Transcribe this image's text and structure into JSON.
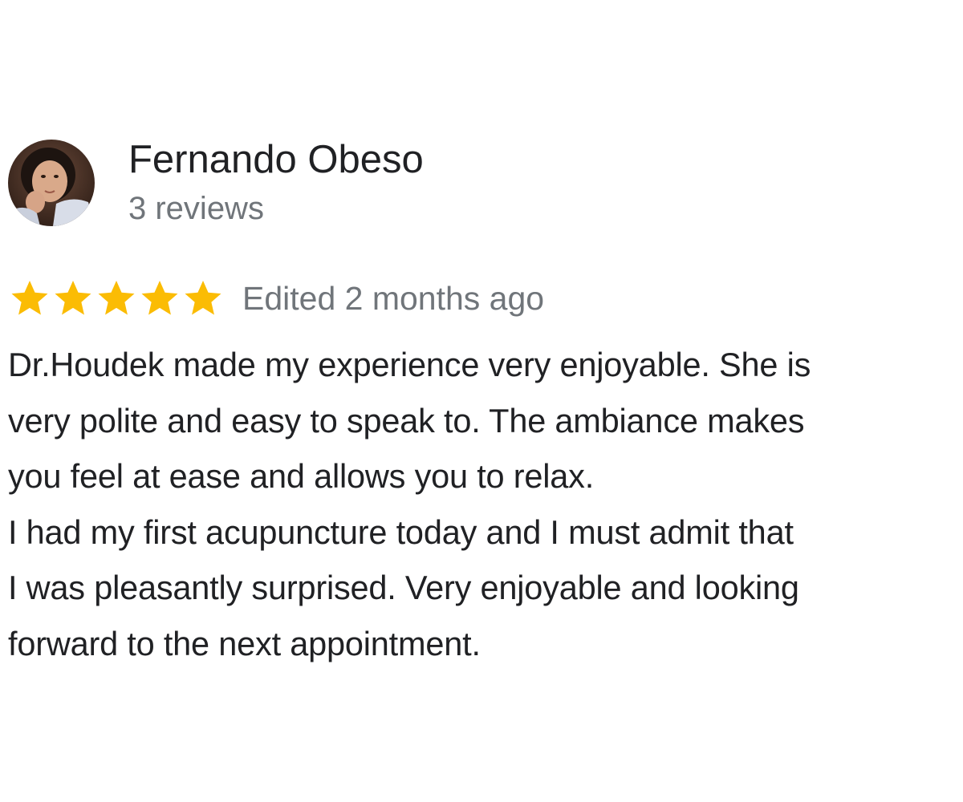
{
  "review": {
    "author": {
      "name": "Fernando Obeso",
      "review_count": "3 reviews",
      "avatar_icon": "user-photo-avatar"
    },
    "rating": {
      "stars": 5,
      "max_stars": 5,
      "star_color": "#fbbc04",
      "edited": "Edited 2 months ago"
    },
    "text_lines": [
      "Dr.Houdek made my experience very enjoyable. She is",
      "very polite and easy to speak to. The ambiance makes",
      "you feel at ease and allows you to relax.",
      "I had my first acupuncture today and I must admit that",
      "I was pleasantly surprised. Very enjoyable and looking",
      "forward to the next appointment."
    ]
  }
}
